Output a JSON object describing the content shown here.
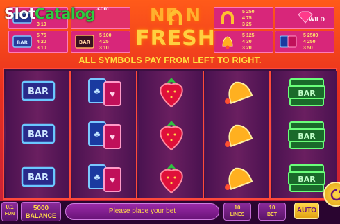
{
  "watermark": {
    "slot": "Slot",
    "catalog": "Catalog",
    "com": ".com"
  },
  "paytable": {
    "left": [
      {
        "symbol": "single-bar-icon",
        "pays": [
          "",
          "",
          "3 10"
        ]
      },
      {
        "symbol": "single-bar-icon",
        "label": "BAR",
        "pays": [
          "5 75",
          "4 20",
          "3 10"
        ]
      },
      {
        "symbol": "triple-bar-icon",
        "label": "BAR",
        "pays": [
          "5 100",
          "4 25",
          "3 10"
        ]
      }
    ],
    "right": [
      {
        "symbol": "horseshoe-icon",
        "pays": [
          "5 250",
          "4 75",
          "3 25"
        ]
      },
      {
        "symbol": "gem-icon",
        "label": "WILD",
        "wild_text": "WILD"
      },
      {
        "symbol": "bell-icon",
        "pays": [
          "5 125",
          "4 30",
          "3 20"
        ]
      },
      {
        "symbol": "cards-icon",
        "pays": [
          "5 2500",
          "4 250",
          "3 50"
        ]
      }
    ]
  },
  "logo": {
    "line1": "NE  N",
    "line2": "FRESH"
  },
  "info": "ALL SYMBOLS PAY FROM LEFT TO RIGHT.",
  "reels": [
    [
      "bar",
      "bar",
      "bar"
    ],
    [
      "cards",
      "cards",
      "cards"
    ],
    [
      "strawberry",
      "strawberry",
      "strawberry"
    ],
    [
      "bell",
      "bell",
      "bell"
    ],
    [
      "triple-bar",
      "triple-bar",
      "triple-bar"
    ]
  ],
  "symbol_text": {
    "bar": "BAR"
  },
  "bottom": {
    "fun_value": "0.1",
    "fun_label": "FUN",
    "balance_value": "5000",
    "balance_label": "BALANCE",
    "message": "Please place your bet",
    "lines_value": "10",
    "lines_label": "LINES",
    "bet_value": "10",
    "bet_label": "BET",
    "auto_label": "AUTO"
  },
  "colors": {
    "accent": "#ffd84a",
    "panel": "#d8267a",
    "reel_border": "#ff4a3a"
  }
}
